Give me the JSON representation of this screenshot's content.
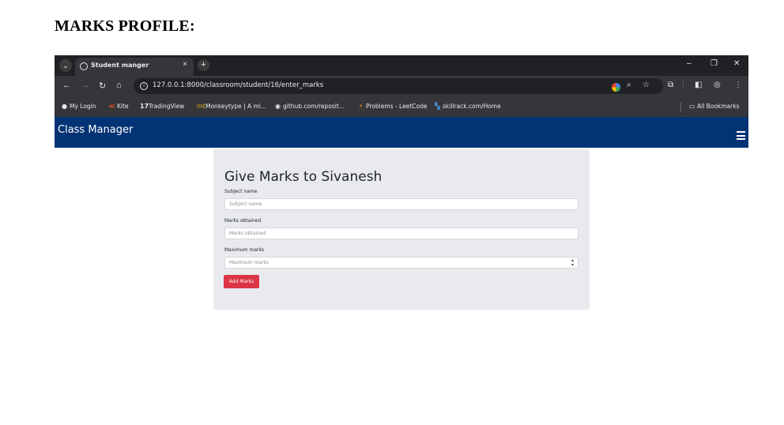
{
  "document": {
    "heading": "MARKS PROFILE:"
  },
  "browser": {
    "tab_title": "Student manger",
    "tab_close": "×",
    "new_tab": "+",
    "window_controls": {
      "minimize": "–",
      "restore": "❐",
      "close": "✕"
    },
    "url": "127.0.0.1:8000/classroom/student/16/enter_marks",
    "bookmarks": [
      {
        "label": "My Login",
        "icon": "globe-icon"
      },
      {
        "label": "Kite",
        "icon": "kite-icon"
      },
      {
        "label": "TradingView",
        "icon": "tradingview-icon"
      },
      {
        "label": "Monkeytype | A mi...",
        "icon": "monkeytype-icon"
      },
      {
        "label": "github.com/reposit...",
        "icon": "github-icon"
      },
      {
        "label": "Problems - LeetCode",
        "icon": "leetcode-icon"
      },
      {
        "label": "skillrack.com/Home",
        "icon": "skillrack-icon"
      }
    ],
    "all_bookmarks": "All Bookmarks"
  },
  "app": {
    "brand": "Class Manager",
    "accent_color": "#023375"
  },
  "form": {
    "title": "Give Marks to Sivanesh",
    "fields": [
      {
        "label": "Subject name",
        "placeholder": "Subject name"
      },
      {
        "label": "Marks obtained",
        "placeholder": "Marks obtained"
      },
      {
        "label": "Maximum marks",
        "placeholder": "Maximum marks"
      }
    ],
    "submit_label": "Add Marks",
    "submit_color": "#dc3545"
  }
}
